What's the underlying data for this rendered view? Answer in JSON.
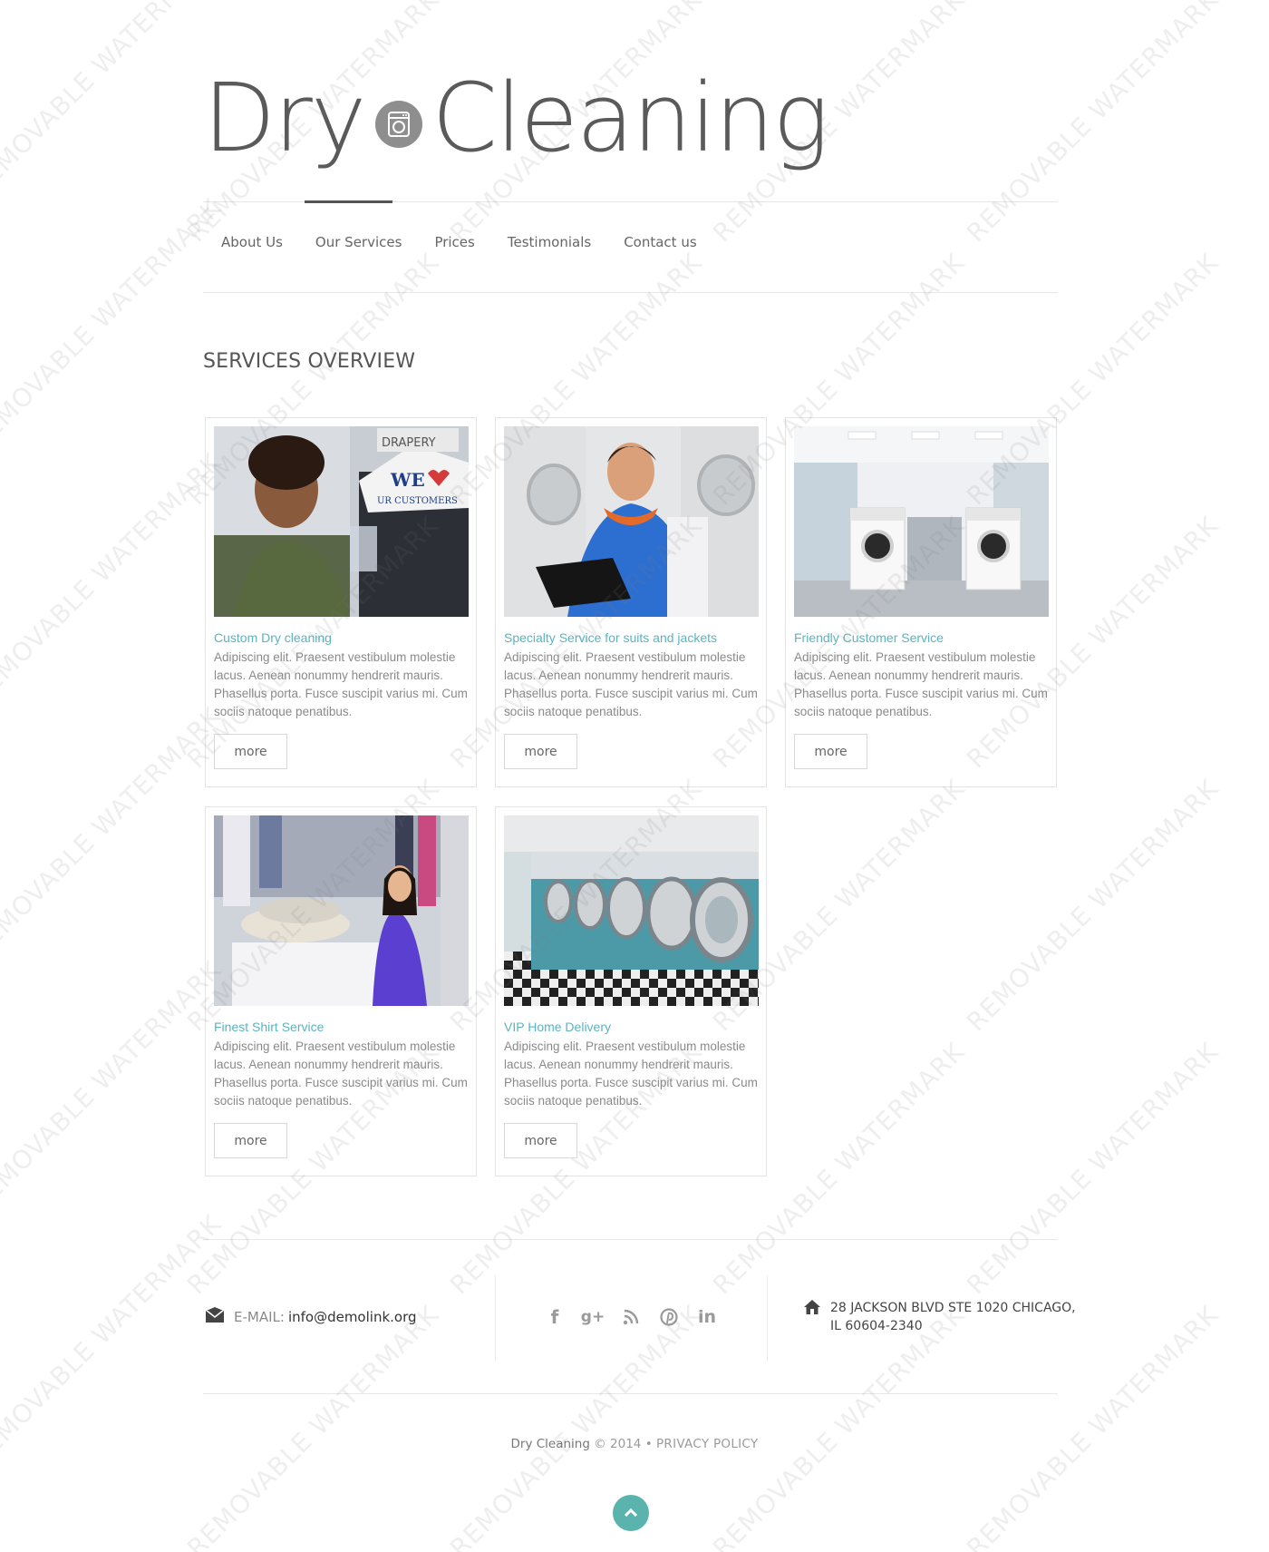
{
  "logo": {
    "word1": "Dry",
    "word2": "Cleaning",
    "icon": "washing-machine-icon"
  },
  "nav": {
    "items": [
      {
        "label": "About Us"
      },
      {
        "label": "Our Services",
        "active": true
      },
      {
        "label": "Prices"
      },
      {
        "label": "Testimonials"
      },
      {
        "label": "Contact us"
      }
    ]
  },
  "section_title": "SERVICES OVERVIEW",
  "services": [
    {
      "title": "Custom Dry cleaning",
      "description": "Adipiscing elit. Praesent vestibulum molestie lacus. Aenean nonummy hendrerit mauris. Phasellus porta. Fusce suscipit varius mi. Cum sociis natoque penatibus.",
      "button": "more"
    },
    {
      "title": "Specialty Service for suits and jackets",
      "description": "Adipiscing elit. Praesent vestibulum molestie lacus. Aenean nonummy hendrerit mauris. Phasellus porta. Fusce suscipit varius mi. Cum sociis natoque penatibus.",
      "button": "more"
    },
    {
      "title": "Friendly Customer Service",
      "description": "Adipiscing elit. Praesent vestibulum molestie lacus. Aenean nonummy hendrerit mauris. Phasellus porta. Fusce suscipit varius mi. Cum sociis natoque penatibus.",
      "button": "more"
    },
    {
      "title": "Finest Shirt Service",
      "description": "Adipiscing elit. Praesent vestibulum molestie lacus. Aenean nonummy hendrerit mauris. Phasellus porta. Fusce suscipit varius mi. Cum sociis natoque penatibus.",
      "button": "more"
    },
    {
      "title": "VIP Home Delivery",
      "description": "Adipiscing elit. Praesent vestibulum molestie lacus. Aenean nonummy hendrerit mauris. Phasellus porta. Fusce suscipit varius mi. Cum sociis natoque penatibus.",
      "button": "more"
    }
  ],
  "images": [
    "hanging-garments-man-photo",
    "laundry-attendant-clipboard-photo",
    "laundromat-interior-photo",
    "woman-shirt-counter-photo",
    "washing-machines-row-photo"
  ],
  "footer": {
    "email_label": "E-MAIL:",
    "email": "info@demolink.org",
    "socials": [
      "facebook-icon",
      "google-plus-icon",
      "rss-icon",
      "pinterest-icon",
      "linkedin-icon"
    ],
    "address_line1": "28 JACKSON BLVD STE 1020 CHICAGO,",
    "address_line2": "IL 60604-2340",
    "copyright_brand": "Dry Cleaning",
    "copyright_year": "© 2014",
    "bullet": "•",
    "privacy": "PRIVACY POLICY"
  },
  "watermark": "REMOVABLE WATERMARK",
  "colors": {
    "accent": "#5ab4bf",
    "to_top": "#5ab4ad",
    "nav_active": "#555555"
  }
}
